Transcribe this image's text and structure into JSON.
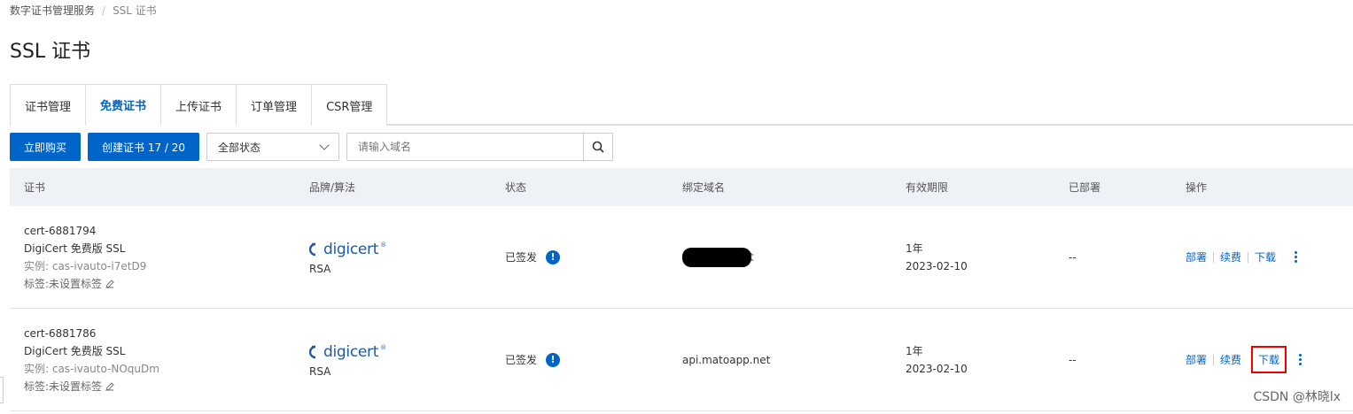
{
  "breadcrumb": {
    "parent": "数字证书管理服务",
    "separator": "/",
    "current": "SSL 证书"
  },
  "page_title": "SSL 证书",
  "tabs": [
    {
      "label": "证书管理",
      "active": false
    },
    {
      "label": "免费证书",
      "active": true
    },
    {
      "label": "上传证书",
      "active": false
    },
    {
      "label": "订单管理",
      "active": false
    },
    {
      "label": "CSR管理",
      "active": false
    }
  ],
  "toolbar": {
    "buy_label": "立即购买",
    "create_label": "创建证书 17 / 20",
    "status_select": "全部状态",
    "search_placeholder": "请输入域名"
  },
  "table": {
    "headers": [
      "证书",
      "品牌/算法",
      "状态",
      "绑定域名",
      "有效期限",
      "已部署",
      "操作"
    ],
    "rows": [
      {
        "cert_id": "cert-6881794",
        "cert_name": "DigiCert 免费版 SSL",
        "instance": "实例: cas-ivauto-i7etD9",
        "tag": "标签:未设置标签",
        "brand": "digicert",
        "algorithm": "RSA",
        "status": "已签发",
        "domain_suffix": "t",
        "validity_term": "1年",
        "validity_date": "2023-02-10",
        "deployed": "--",
        "actions": {
          "deploy": "部署",
          "renew": "续费",
          "download": "下载"
        }
      },
      {
        "cert_id": "cert-6881786",
        "cert_name": "DigiCert 免费版 SSL",
        "instance": "实例: cas-ivauto-NOquDm",
        "tag": "标签:未设置标签",
        "brand": "digicert",
        "algorithm": "RSA",
        "status": "已签发",
        "domain": "api.matoapp.net",
        "validity_term": "1年",
        "validity_date": "2023-02-10",
        "deployed": "--",
        "actions": {
          "deploy": "部署",
          "renew": "续费",
          "download": "下载"
        }
      }
    ]
  },
  "watermark": "CSDN @林晓lx",
  "colors": {
    "primary": "#0064c8",
    "highlight": "#e00000",
    "header_bg": "#eef1f6"
  }
}
